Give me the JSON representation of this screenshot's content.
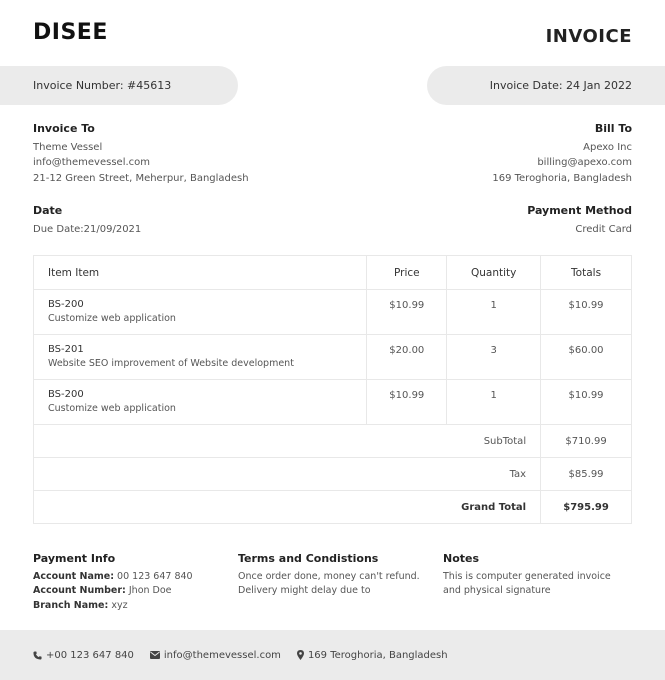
{
  "brand": "DISEE",
  "document_title": "INVOICE",
  "invoice_number": "Invoice Number: #45613",
  "invoice_date": "Invoice Date: 24 Jan 2022",
  "invoice_to": {
    "heading": "Invoice To",
    "name": "Theme Vessel",
    "email": "info@themevessel.com",
    "address": "21-12 Green Street, Meherpur, Bangladesh"
  },
  "bill_to": {
    "heading": "Bill To",
    "name": "Apexo Inc",
    "email": "billing@apexo.com",
    "address": "169 Teroghoria, Bangladesh"
  },
  "date": {
    "heading": "Date",
    "due": "Due Date:21/09/2021"
  },
  "payment_method": {
    "heading": "Payment Method",
    "value": "Credit Card"
  },
  "table": {
    "headers": [
      "Item Item",
      "Price",
      "Quantity",
      "Totals"
    ],
    "rows": [
      {
        "code": "BS-200",
        "desc": "Customize web application",
        "price": "$10.99",
        "qty": "1",
        "total": "$10.99"
      },
      {
        "code": "BS-201",
        "desc": "Website SEO improvement of Website development",
        "price": "$20.00",
        "qty": "3",
        "total": "$60.00"
      },
      {
        "code": "BS-200",
        "desc": "Customize web application",
        "price": "$10.99",
        "qty": "1",
        "total": "$10.99"
      }
    ],
    "subtotal_label": "SubTotal",
    "subtotal_value": "$710.99",
    "tax_label": "Tax",
    "tax_value": "$85.99",
    "grand_label": "Grand Total",
    "grand_value": "$795.99"
  },
  "payment_info": {
    "heading": "Payment Info",
    "account_name_label": "Account Name:",
    "account_name": " 00 123 647 840",
    "account_number_label": "Account Number:",
    "account_number": " Jhon Doe",
    "branch_name_label": "Branch Name:",
    "branch_name": " xyz"
  },
  "terms": {
    "heading": "Terms and Condistions",
    "line1": "Once order done, money can't refund.",
    "line2": "Delivery might delay due to"
  },
  "notes": {
    "heading": "Notes",
    "line1": "This is computer generated invoice",
    "line2": "and physical signature"
  },
  "footer": {
    "phone": "+00 123 647 840",
    "email": "info@themevessel.com",
    "address": "169 Teroghoria, Bangladesh",
    "phone_icon": "phone-icon",
    "email_icon": "envelope-icon",
    "address_icon": "map-marker-icon"
  }
}
